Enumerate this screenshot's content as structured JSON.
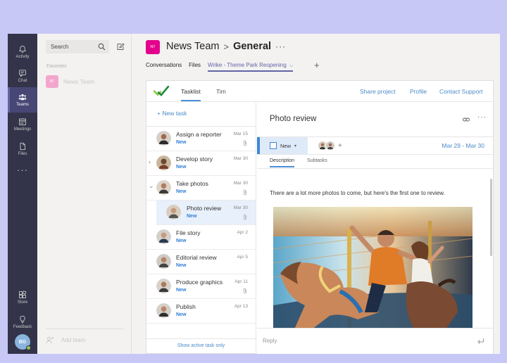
{
  "rail": {
    "items": [
      {
        "label": "Activity",
        "icon": "bell-icon"
      },
      {
        "label": "Chat",
        "icon": "chat-icon"
      },
      {
        "label": "Teams",
        "icon": "teams-icon"
      },
      {
        "label": "Meetings",
        "icon": "calendar-icon"
      },
      {
        "label": "Files",
        "icon": "file-icon"
      },
      {
        "label": "Store",
        "icon": "store-icon"
      },
      {
        "label": "Feedback",
        "icon": "lightbulb-icon"
      }
    ],
    "more": "···",
    "user_initials": "BG"
  },
  "left_panel": {
    "search_placeholder": "Search",
    "favorites_label": "Favorites",
    "favorite_team": {
      "initials": "NT",
      "name": "News Team"
    },
    "add_team_label": "Add team"
  },
  "header": {
    "team_initials": "NT",
    "team_name": "News Team",
    "separator": ">",
    "channel": "General",
    "more": "···",
    "tabs": [
      "Conversations",
      "Files",
      "Wrike - Theme Park Reopening"
    ],
    "active_tab_chevron": "⌵",
    "add_tab": "+"
  },
  "app": {
    "tabs": [
      "Tasklist",
      "Tim"
    ],
    "links": [
      "Share project",
      "Profile",
      "Contact Support"
    ],
    "new_task": "+ New task",
    "tasks": [
      {
        "name": "Assign a reporter",
        "status": "New",
        "date": "Mar 15",
        "attachment": true
      },
      {
        "name": "Develop story",
        "status": "New",
        "date": "Mar 30",
        "attachment": false,
        "caret": "›"
      },
      {
        "name": "Take photos",
        "status": "New",
        "date": "Mar 30",
        "attachment": true,
        "caret": "⌄"
      },
      {
        "name": "Photo review",
        "status": "New",
        "date": "Mar 30",
        "attachment": true,
        "subtask": true
      },
      {
        "name": "File story",
        "status": "New",
        "date": "Apr 2",
        "attachment": false
      },
      {
        "name": "Editorial review",
        "status": "New",
        "date": "Apr 5",
        "attachment": false
      },
      {
        "name": "Produce graphics",
        "status": "New",
        "date": "Apr 11",
        "attachment": true
      },
      {
        "name": "Publish",
        "status": "New",
        "date": "Apr 13",
        "attachment": false
      }
    ],
    "show_active": "Show active task only",
    "detail": {
      "title": "Photo review",
      "more": "···",
      "status": "New",
      "status_caret": "▾",
      "add_assignee": "+",
      "date_range": "Mar 29 - Mar 30",
      "tabs": [
        "Description",
        "Subtasks"
      ],
      "description": "There are a lot more photos to come, but here's the first one to review.",
      "reply_placeholder": "Reply"
    }
  },
  "colors": {
    "rail_bg": "#33344a",
    "teams_purple": "#6264a7",
    "team_badge": "#e3008c",
    "wrike_blue": "#4a8ac9",
    "status_blue": "#2f7ed8"
  }
}
